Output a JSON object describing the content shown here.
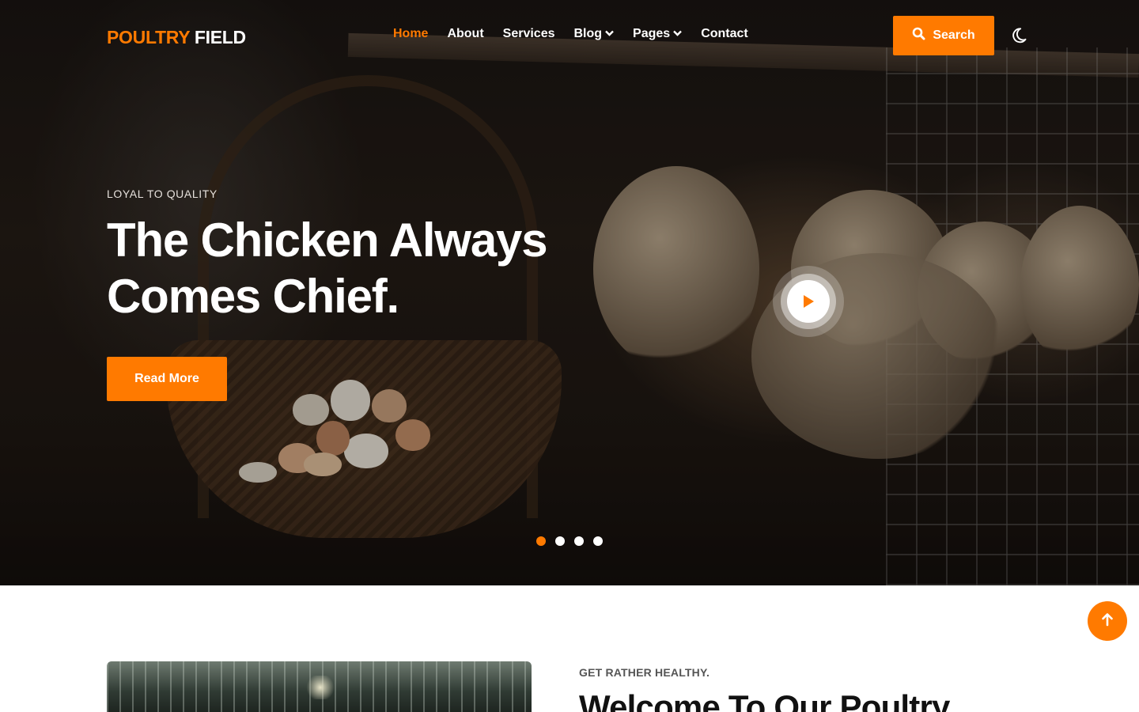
{
  "brand": {
    "part1": "POULTRY",
    "part2": "FIELD",
    "accent_color": "#ff7a00"
  },
  "nav": {
    "items": [
      {
        "label": "Home",
        "active": true,
        "has_dropdown": false
      },
      {
        "label": "About",
        "active": false,
        "has_dropdown": false
      },
      {
        "label": "Services",
        "active": false,
        "has_dropdown": false
      },
      {
        "label": "Blog",
        "active": false,
        "has_dropdown": true
      },
      {
        "label": "Pages",
        "active": false,
        "has_dropdown": true
      },
      {
        "label": "Contact",
        "active": false,
        "has_dropdown": false
      }
    ],
    "search_label": "Search",
    "search_icon": "search-icon",
    "theme_icon": "moon-icon"
  },
  "hero": {
    "eyebrow": "LOYAL TO QUALITY",
    "headline_line1": "The Chicken Always",
    "headline_line2": "Comes Chief.",
    "cta_label": "Read More",
    "play_icon": "play-icon",
    "slides": {
      "count": 4,
      "active_index": 0
    }
  },
  "about": {
    "eyebrow": "GET RATHER HEALTHY.",
    "title": "Welcome To Our Poultry"
  },
  "scroll_top_icon": "arrow-up-icon"
}
